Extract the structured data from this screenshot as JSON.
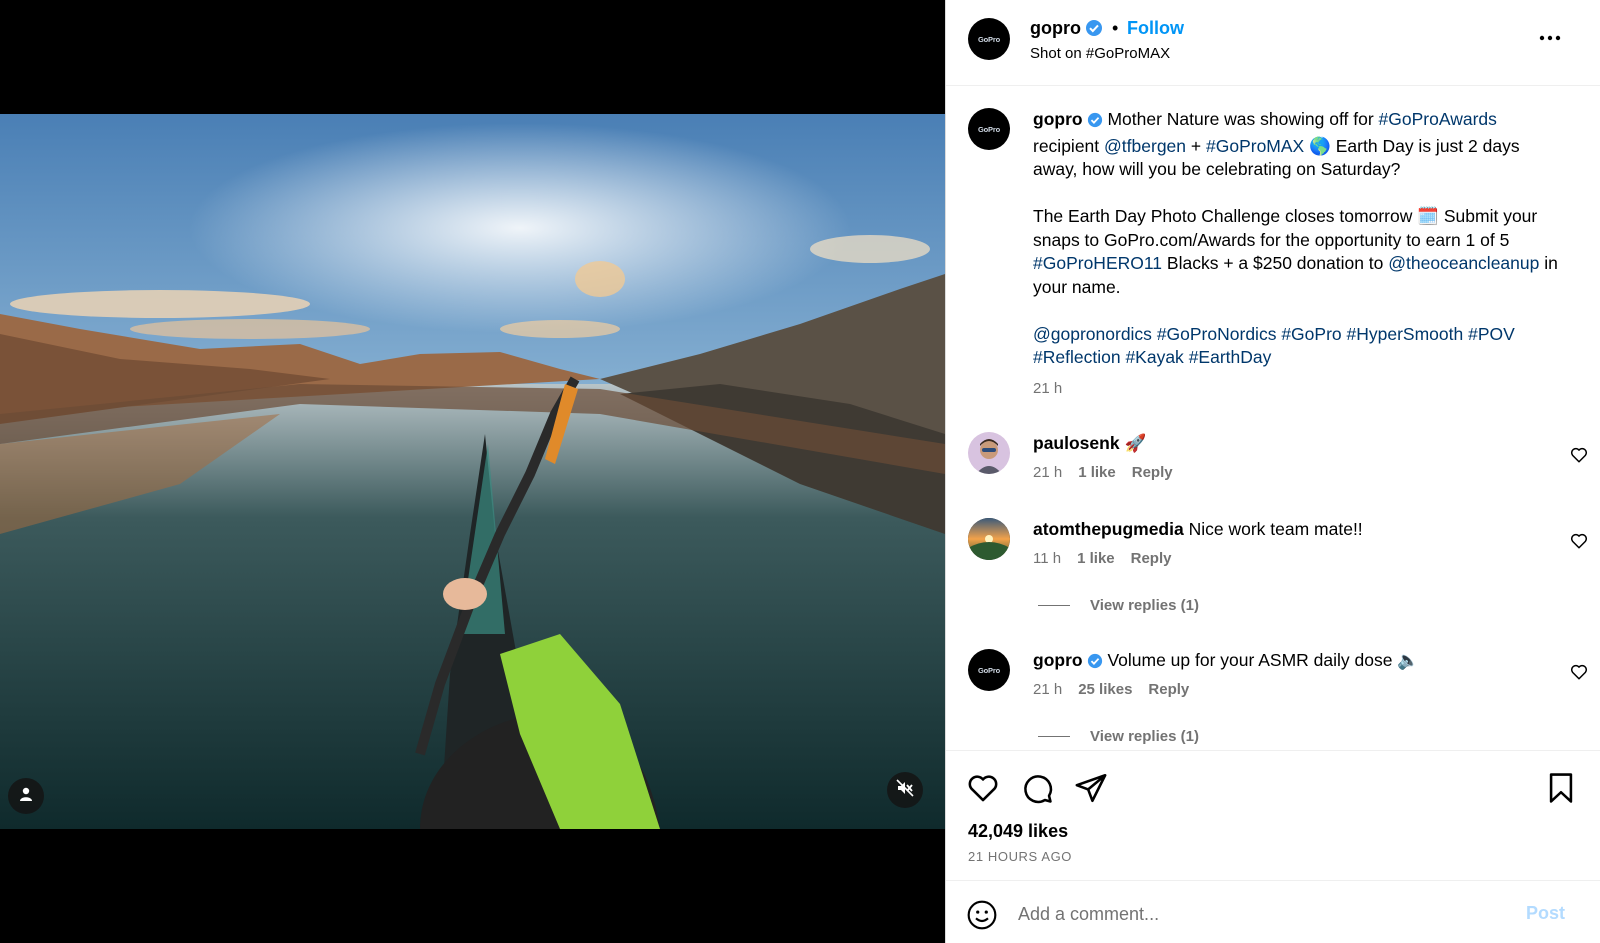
{
  "colors": {
    "accent": "#0095f6",
    "link": "#00376b",
    "muted": "#737373",
    "verified": "#3897f0",
    "post_disabled": "#b3dbff"
  },
  "media": {
    "type": "video",
    "tag_icon": "user-icon",
    "mute_icon": "speaker-muted-icon"
  },
  "header": {
    "username": "gopro",
    "avatar_text": "GoPro",
    "dot": "•",
    "follow_label": "Follow",
    "subtitle": "Shot on #GoProMAX",
    "more_icon": "more-dots-icon"
  },
  "caption": {
    "username": "gopro",
    "line1_text": "Mother Nature was showing off for",
    "tag_awards": "#GoProAwards",
    "line2_pre": "recipient",
    "mention_tfbergen": "@tfbergen",
    "plus": "+",
    "tag_max": "#GoProMAX",
    "line2_post": "🌎 Earth Day is just 2 days away, how will you be celebrating on Saturday?",
    "para2_text": "The Earth Day Photo Challenge closes tomorrow 🗓️ Submit your snaps to GoPro.com/Awards for the opportunity to earn 1 of 5",
    "tag_hero11": "#GoProHERO11",
    "para2_mid": "Blacks + a $250 donation to",
    "mention_ocean": "@theoceancleanup",
    "para2_end": "in your name.",
    "tags": [
      "@gopronordics",
      "#GoProNordics",
      "#GoPro",
      "#HyperSmooth",
      "#POV",
      "#Reflection",
      "#Kayak",
      "#EarthDay"
    ],
    "time": "21 h"
  },
  "comments": [
    {
      "username": "paulosenk",
      "text": "🚀",
      "time": "21 h",
      "likes": "1 like",
      "reply": "Reply"
    },
    {
      "username": "atomthepugmedia",
      "text": "Nice work team mate!!",
      "time": "11 h",
      "likes": "1 like",
      "reply": "Reply",
      "view_replies": "View replies (1)"
    },
    {
      "username": "gopro",
      "avatar_text": "GoPro",
      "text": "Volume up for your ASMR daily dose 🔈",
      "time": "21 h",
      "likes": "25 likes",
      "reply": "Reply",
      "view_replies": "View replies (1)"
    }
  ],
  "actions": {
    "like_icon": "heart-icon",
    "comment_icon": "comment-icon",
    "share_icon": "send-icon",
    "save_icon": "bookmark-icon",
    "likes_count": "42,049 likes",
    "posted_ago": "21 HOURS AGO"
  },
  "add_comment": {
    "emoji_icon": "emoji-icon",
    "placeholder": "Add a comment...",
    "post_label": "Post"
  }
}
